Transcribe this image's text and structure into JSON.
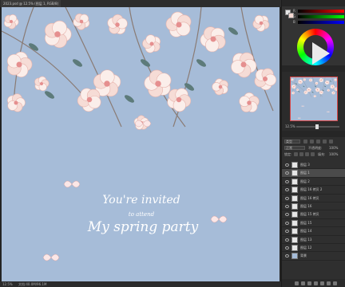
{
  "document": {
    "tab_title": "2023.psd @ 12.5% (图层 1, RGB/8)",
    "status": [
      "12.5%",
      "文档:40.0M/96.1M"
    ],
    "background_color": "#a6bcd8",
    "invite": {
      "line1": "You're invited",
      "line2": "to attend",
      "line3": "My spring party"
    }
  },
  "panel": {
    "color_tabs": [
      "颜色",
      "色板"
    ],
    "sliders": [
      {
        "label": "R",
        "gradient": "linear-gradient(90deg,#000,#f00)"
      },
      {
        "label": "G",
        "gradient": "linear-gradient(90deg,#000,#0f0)"
      },
      {
        "label": "B",
        "gradient": "linear-gradient(90deg,#000,#00f)"
      }
    ],
    "navigator_tab": "导航器",
    "navigator_zoom": "12.5%",
    "layer_tabs": [
      "图层",
      "通道",
      "路径"
    ],
    "kind_label": "类型",
    "blend_mode": "正常",
    "opacity_label": "不透明度:",
    "opacity_value": "100%",
    "lock_label": "锁定:",
    "fill_label": "填充:",
    "fill_value": "100%",
    "layers": [
      {
        "name": "图层 3"
      },
      {
        "name": "图层 1",
        "active": true
      },
      {
        "name": "图层 2"
      },
      {
        "name": "图层 16 拷贝 2"
      },
      {
        "name": "图层 16 拷贝"
      },
      {
        "name": "图层 16"
      },
      {
        "name": "图层 15 拷贝"
      },
      {
        "name": "图层 15"
      },
      {
        "name": "图层 14"
      },
      {
        "name": "图层 13"
      },
      {
        "name": "图层 12"
      },
      {
        "name": "背景",
        "background": true
      }
    ]
  }
}
